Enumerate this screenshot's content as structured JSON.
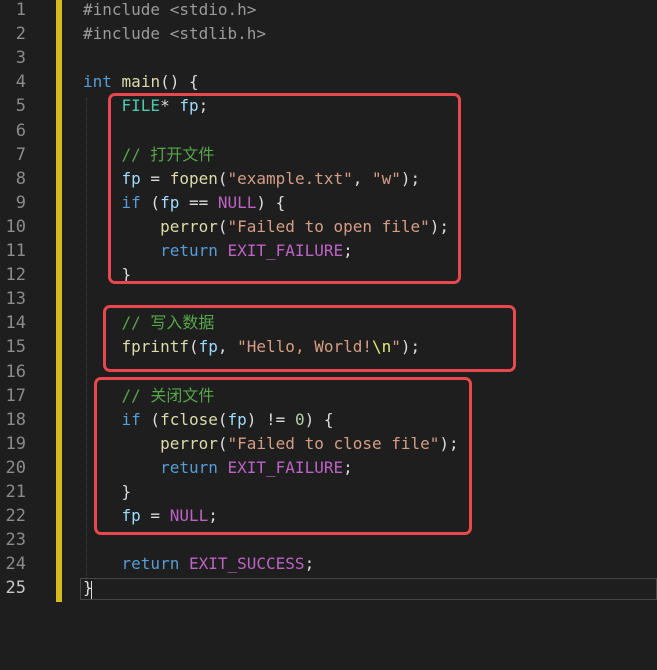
{
  "editor": {
    "lines": [
      {
        "num": "1",
        "tokens": [
          {
            "t": "#include <stdio.h>",
            "c": "pre"
          }
        ]
      },
      {
        "num": "2",
        "tokens": [
          {
            "t": "#include <stdlib.h>",
            "c": "pre"
          }
        ]
      },
      {
        "num": "3",
        "tokens": []
      },
      {
        "num": "4",
        "tokens": [
          {
            "t": "int",
            "c": "kw"
          },
          {
            "t": " ",
            "c": "pl"
          },
          {
            "t": "main",
            "c": "fn"
          },
          {
            "t": "() {",
            "c": "pl"
          }
        ]
      },
      {
        "num": "5",
        "tokens": [
          {
            "t": "    ",
            "c": "pl"
          },
          {
            "t": "FILE",
            "c": "ty"
          },
          {
            "t": "* ",
            "c": "pl"
          },
          {
            "t": "fp",
            "c": "var"
          },
          {
            "t": ";",
            "c": "pl"
          }
        ]
      },
      {
        "num": "6",
        "tokens": []
      },
      {
        "num": "7",
        "tokens": [
          {
            "t": "    // 打开文件",
            "c": "com"
          }
        ]
      },
      {
        "num": "8",
        "tokens": [
          {
            "t": "    ",
            "c": "pl"
          },
          {
            "t": "fp",
            "c": "var"
          },
          {
            "t": " = ",
            "c": "pl"
          },
          {
            "t": "fopen",
            "c": "fn"
          },
          {
            "t": "(",
            "c": "pl"
          },
          {
            "t": "\"example.txt\"",
            "c": "str"
          },
          {
            "t": ", ",
            "c": "pl"
          },
          {
            "t": "\"w\"",
            "c": "str"
          },
          {
            "t": ");",
            "c": "pl"
          }
        ]
      },
      {
        "num": "9",
        "tokens": [
          {
            "t": "    ",
            "c": "pl"
          },
          {
            "t": "if",
            "c": "kw"
          },
          {
            "t": " (",
            "c": "pl"
          },
          {
            "t": "fp",
            "c": "var"
          },
          {
            "t": " == ",
            "c": "pl"
          },
          {
            "t": "NULL",
            "c": "mac"
          },
          {
            "t": ") {",
            "c": "pl"
          }
        ]
      },
      {
        "num": "10",
        "tokens": [
          {
            "t": "        ",
            "c": "pl"
          },
          {
            "t": "perror",
            "c": "fn"
          },
          {
            "t": "(",
            "c": "pl"
          },
          {
            "t": "\"Failed to open file\"",
            "c": "str"
          },
          {
            "t": ");",
            "c": "pl"
          }
        ]
      },
      {
        "num": "11",
        "tokens": [
          {
            "t": "        ",
            "c": "pl"
          },
          {
            "t": "return",
            "c": "kw"
          },
          {
            "t": " ",
            "c": "pl"
          },
          {
            "t": "EXIT_FAILURE",
            "c": "mac"
          },
          {
            "t": ";",
            "c": "pl"
          }
        ]
      },
      {
        "num": "12",
        "tokens": [
          {
            "t": "    }",
            "c": "pl"
          }
        ]
      },
      {
        "num": "13",
        "tokens": []
      },
      {
        "num": "14",
        "tokens": [
          {
            "t": "    // 写入数据",
            "c": "com"
          }
        ]
      },
      {
        "num": "15",
        "tokens": [
          {
            "t": "    ",
            "c": "pl"
          },
          {
            "t": "fprintf",
            "c": "fn"
          },
          {
            "t": "(",
            "c": "pl"
          },
          {
            "t": "fp",
            "c": "var"
          },
          {
            "t": ", ",
            "c": "pl"
          },
          {
            "t": "\"Hello, World!",
            "c": "str"
          },
          {
            "t": "\\n",
            "c": "esc"
          },
          {
            "t": "\"",
            "c": "str"
          },
          {
            "t": ");",
            "c": "pl"
          }
        ]
      },
      {
        "num": "16",
        "tokens": []
      },
      {
        "num": "17",
        "tokens": [
          {
            "t": "    // 关闭文件",
            "c": "com"
          }
        ]
      },
      {
        "num": "18",
        "tokens": [
          {
            "t": "    ",
            "c": "pl"
          },
          {
            "t": "if",
            "c": "kw"
          },
          {
            "t": " (",
            "c": "pl"
          },
          {
            "t": "fclose",
            "c": "fn"
          },
          {
            "t": "(",
            "c": "pl"
          },
          {
            "t": "fp",
            "c": "var"
          },
          {
            "t": ") != ",
            "c": "pl"
          },
          {
            "t": "0",
            "c": "num"
          },
          {
            "t": ") {",
            "c": "pl"
          }
        ]
      },
      {
        "num": "19",
        "tokens": [
          {
            "t": "        ",
            "c": "pl"
          },
          {
            "t": "perror",
            "c": "fn"
          },
          {
            "t": "(",
            "c": "pl"
          },
          {
            "t": "\"Failed to close file\"",
            "c": "str"
          },
          {
            "t": ");",
            "c": "pl"
          }
        ]
      },
      {
        "num": "20",
        "tokens": [
          {
            "t": "        ",
            "c": "pl"
          },
          {
            "t": "return",
            "c": "kw"
          },
          {
            "t": " ",
            "c": "pl"
          },
          {
            "t": "EXIT_FAILURE",
            "c": "mac"
          },
          {
            "t": ";",
            "c": "pl"
          }
        ]
      },
      {
        "num": "21",
        "tokens": [
          {
            "t": "    }",
            "c": "pl"
          }
        ]
      },
      {
        "num": "22",
        "tokens": [
          {
            "t": "    ",
            "c": "pl"
          },
          {
            "t": "fp",
            "c": "var"
          },
          {
            "t": " = ",
            "c": "pl"
          },
          {
            "t": "NULL",
            "c": "mac"
          },
          {
            "t": ";",
            "c": "pl"
          }
        ]
      },
      {
        "num": "23",
        "tokens": []
      },
      {
        "num": "24",
        "tokens": [
          {
            "t": "    ",
            "c": "pl"
          },
          {
            "t": "return",
            "c": "kw"
          },
          {
            "t": " ",
            "c": "pl"
          },
          {
            "t": "EXIT_SUCCESS",
            "c": "mac"
          },
          {
            "t": ";",
            "c": "pl"
          }
        ]
      },
      {
        "num": "25",
        "tokens": [
          {
            "t": "}",
            "c": "pl"
          }
        ]
      }
    ],
    "active_line": "25",
    "colors": {
      "background": "#1e1e1e",
      "highlight_box": "#e8474d",
      "change_bar": "#d7ba1f"
    }
  }
}
